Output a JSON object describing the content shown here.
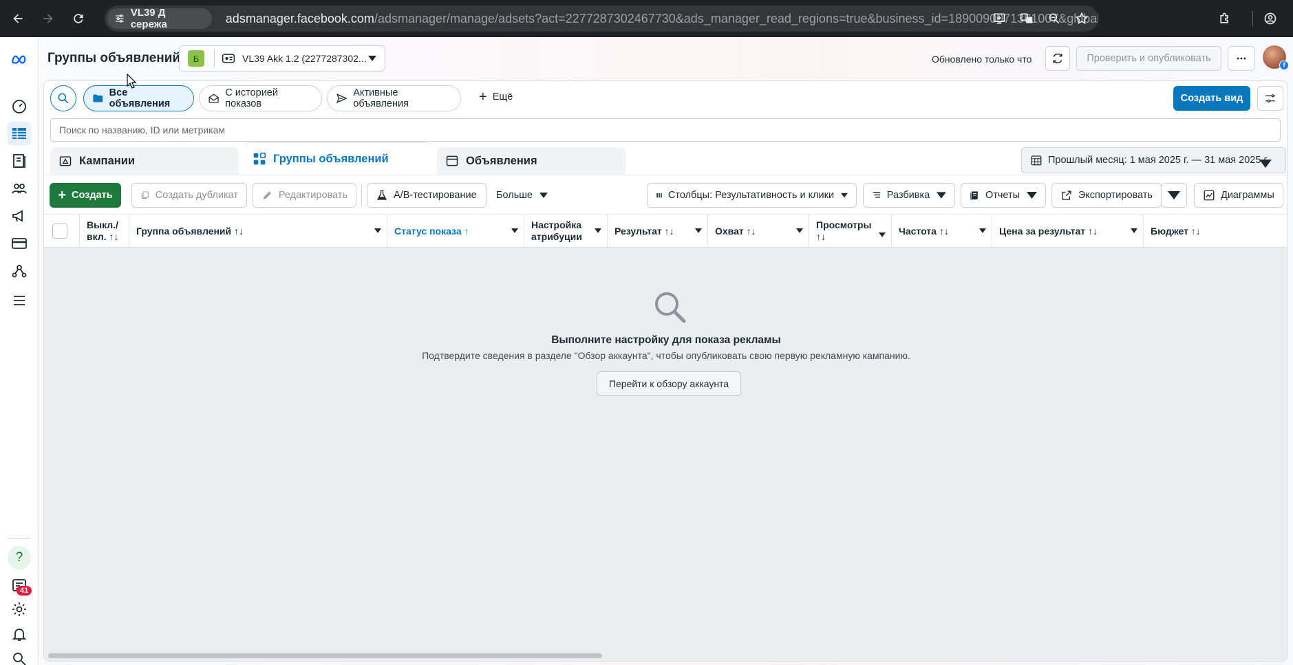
{
  "browser": {
    "profile_chip": "VL39 Д сережа",
    "url_host": "adsmanager.facebook.com",
    "url_rest": "/adsmanager/manage/adsets?act=2277287302467730&ads_manager_read_regions=true&business_id=1890090071361007&global_sc..."
  },
  "header": {
    "title": "Группы объявлений",
    "account_badge": "Б",
    "account_name": "VL39 Akk 1.2 (2277287302...",
    "updated_text": "Обновлено только что",
    "publish_label": "Проверить и опубликовать"
  },
  "filters": {
    "all_ads": "Все объявления",
    "with_history": "С историей показов",
    "active_ads": "Активные объявления",
    "more": "Ещё",
    "create_view": "Создать вид",
    "search_placeholder": "Поиск по названию, ID или метрикам"
  },
  "tabs": {
    "campaigns": "Кампании",
    "adsets": "Группы объявлений",
    "ads": "Объявления"
  },
  "date_range": "Прошлый месяц: 1 мая 2025 г. — 31 мая 2025 г.",
  "toolbar": {
    "create": "Создать",
    "duplicate": "Создать дубликат",
    "edit": "Редактировать",
    "ab_test": "A/B-тестирование",
    "more": "Больше",
    "columns": "Столбцы: Результативность и клики",
    "breakdown": "Разбивка",
    "reports": "Отчеты",
    "export": "Экспортировать",
    "charts": "Диаграммы"
  },
  "table": {
    "columns": [
      {
        "label": "Выкл./ вкл. ↑↓"
      },
      {
        "label": "Группа объявлений ↑↓"
      },
      {
        "label": "Статус показа ↑"
      },
      {
        "label": "Настройка атрибуции"
      },
      {
        "label": "Результат ↑↓"
      },
      {
        "label": "Охват ↑↓"
      },
      {
        "label": "Просмотры ↑↓"
      },
      {
        "label": "Частота ↑↓"
      },
      {
        "label": "Цена за результат ↑↓"
      },
      {
        "label": "Бюджет ↑↓"
      }
    ],
    "sorted_column": "Статус показа"
  },
  "empty_state": {
    "title": "Выполните настройку для показа рекламы",
    "description": "Подтвердите сведения в разделе \"Обзор аккаунта\", чтобы опубликовать свою первую рекламную кампанию.",
    "button": "Перейти к обзору аккаунта"
  },
  "rail": {
    "notification_count": "41"
  },
  "colors": {
    "accent": "#0a78be",
    "create_green": "#1e7a3c",
    "badge_red": "#e41e3f"
  }
}
